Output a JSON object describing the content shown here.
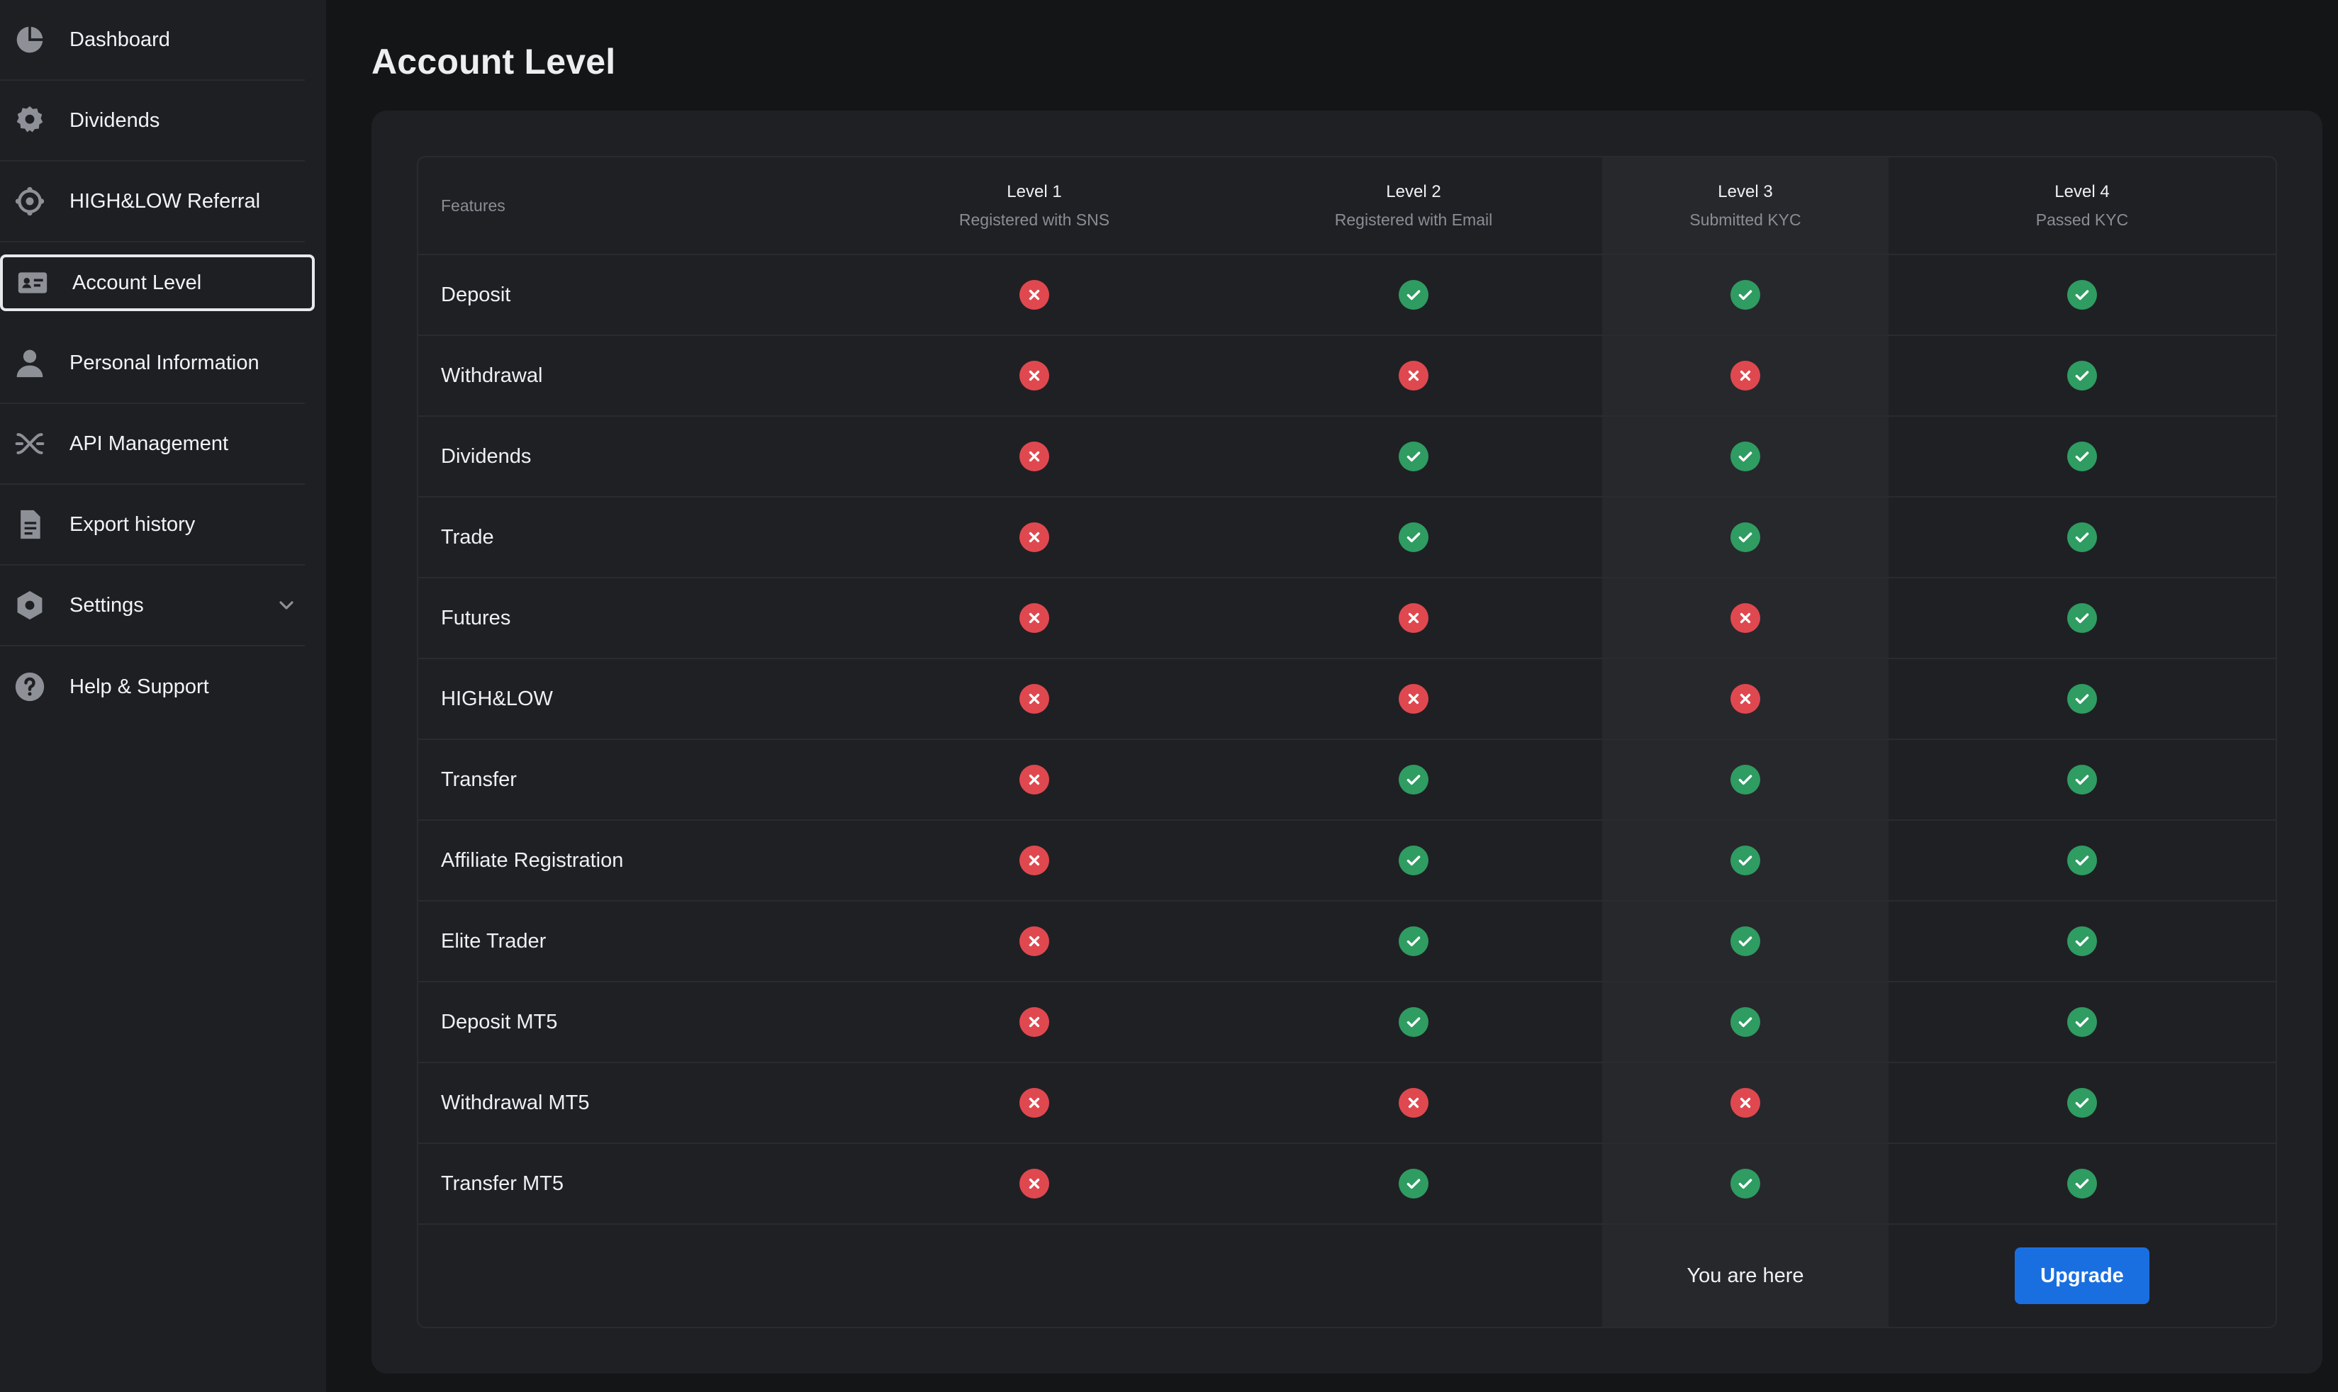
{
  "sidebar": {
    "items": [
      {
        "label": "Dashboard",
        "icon": "chart-pie-icon"
      },
      {
        "label": "Dividends",
        "icon": "badge-icon"
      },
      {
        "label": "HIGH&LOW Referral",
        "icon": "network-icon"
      },
      {
        "label": "Account Level",
        "icon": "id-card-icon",
        "active": true
      },
      {
        "label": "Personal Information",
        "icon": "user-icon"
      },
      {
        "label": "API Management",
        "icon": "api-icon"
      },
      {
        "label": "Export history",
        "icon": "document-icon"
      },
      {
        "label": "Settings",
        "icon": "gear-icon"
      },
      {
        "label": "Help & Support",
        "icon": "help-icon"
      }
    ]
  },
  "page": {
    "title": "Account Level"
  },
  "table": {
    "features_header": "Features",
    "levels": [
      {
        "level": "Level 1",
        "desc": "Registered with SNS"
      },
      {
        "level": "Level 2",
        "desc": "Registered with Email"
      },
      {
        "level": "Level 3",
        "desc": "Submitted KYC"
      },
      {
        "level": "Level 4",
        "desc": "Passed KYC"
      }
    ],
    "rows": [
      {
        "feature": "Deposit",
        "levels": [
          false,
          true,
          true,
          true
        ]
      },
      {
        "feature": "Withdrawal",
        "levels": [
          false,
          false,
          false,
          true
        ]
      },
      {
        "feature": "Dividends",
        "levels": [
          false,
          true,
          true,
          true
        ]
      },
      {
        "feature": "Trade",
        "levels": [
          false,
          true,
          true,
          true
        ]
      },
      {
        "feature": "Futures",
        "levels": [
          false,
          false,
          false,
          true
        ]
      },
      {
        "feature": "HIGH&LOW",
        "levels": [
          false,
          false,
          false,
          true
        ]
      },
      {
        "feature": "Transfer",
        "levels": [
          false,
          true,
          true,
          true
        ]
      },
      {
        "feature": "Affiliate Registration",
        "levels": [
          false,
          true,
          true,
          true
        ]
      },
      {
        "feature": "Elite Trader",
        "levels": [
          false,
          true,
          true,
          true
        ]
      },
      {
        "feature": "Deposit MT5",
        "levels": [
          false,
          true,
          true,
          true
        ]
      },
      {
        "feature": "Withdrawal MT5",
        "levels": [
          false,
          false,
          false,
          true
        ]
      },
      {
        "feature": "Transfer MT5",
        "levels": [
          false,
          true,
          true,
          true
        ]
      }
    ],
    "current_level_label": "You are here",
    "upgrade_label": "Upgrade"
  },
  "colors": {
    "yes": "#2f9c62",
    "no": "#e0484f",
    "accent": "#1a6fe0"
  }
}
